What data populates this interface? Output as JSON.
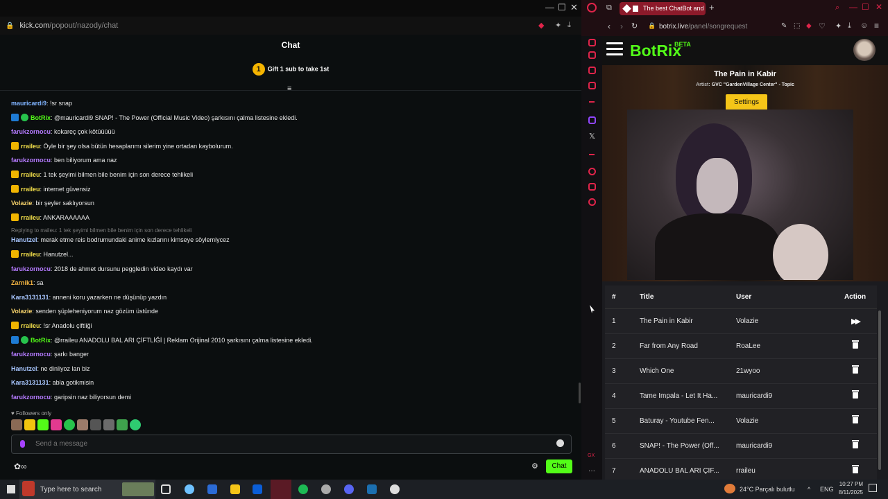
{
  "left_window": {
    "url_host": "kick.com",
    "url_path": "/popout/nazody/chat",
    "chat_title": "Chat",
    "gift_badge": "1",
    "gift_text": "Gift 1 sub to take 1st",
    "messages": [
      {
        "user": "mauricardi9",
        "color": "#7fb3ff",
        "badges": [],
        "text": ": !sr snap"
      },
      {
        "user": "BotRix",
        "color": "#53fc18",
        "badges": [
          "bot",
          "verified"
        ],
        "text": ": @mauricardi9 SNAP! - The Power (Official Music Video) şarkısını çalma listesine ekledi."
      },
      {
        "user": "farukzornocu",
        "color": "#b57bff",
        "badges": [],
        "text": ": kokareç çok kötüüüüü"
      },
      {
        "user": "rraileu",
        "color": "#f5e14b",
        "badges": [
          "crown"
        ],
        "text": ": Öyle bir şey olsa bütün hesaplarımı silerim yine ortadan kaybolurum."
      },
      {
        "user": "farukzornocu",
        "color": "#b57bff",
        "badges": [],
        "text": ": ben biliyorum ama naz"
      },
      {
        "user": "rraileu",
        "color": "#f5e14b",
        "badges": [
          "crown"
        ],
        "text": ": 1 tek şeyimi bilmen bile benim için son derece tehlikeli"
      },
      {
        "user": "rraileu",
        "color": "#f5e14b",
        "badges": [
          "crown"
        ],
        "text": ": internet güvensiz"
      },
      {
        "user": "Volazie",
        "color": "#f7d36b",
        "badges": [],
        "text": ": bir şeyler saklıyorsun"
      },
      {
        "user": "rraileu",
        "color": "#f5e14b",
        "badges": [
          "crown"
        ],
        "text": ": ANKARAAAAAA"
      },
      {
        "reply": "Replying to rraileu: 1 tek şeyimi bilmen bile benim için son derece tehlikeli",
        "user": "Hanutzel",
        "color": "#a8c6ff",
        "badges": [],
        "text": ": merak etme reis bodrumundaki anime kızlarını kimseye söylemiycez"
      },
      {
        "user": "rraileu",
        "color": "#f5e14b",
        "badges": [
          "crown"
        ],
        "text": ": Hanutzel..."
      },
      {
        "user": "farukzornocu",
        "color": "#b57bff",
        "badges": [],
        "text": ": 2018 de ahmet dursunu peggledin video kaydı var"
      },
      {
        "user": "Zarnik1",
        "color": "#f5b642",
        "badges": [],
        "text": ": sa"
      },
      {
        "user": "Kara3131131",
        "color": "#a8c6ff",
        "badges": [],
        "text": ": anneni koru yazarken ne düşünüp yazdın"
      },
      {
        "user": "Volazie",
        "color": "#f7d36b",
        "badges": [],
        "text": ": senden şüpleheniyorum naz gözüm üstünde"
      },
      {
        "user": "rraileu",
        "color": "#f5e14b",
        "badges": [
          "crown"
        ],
        "text": ": !sr Anadolu çiftliği"
      },
      {
        "user": "BotRix",
        "color": "#53fc18",
        "badges": [
          "bot",
          "verified"
        ],
        "text": ": @rraileu ANADOLU BAL ARI ÇİFTLİĞİ | Reklam Orijinal 2010 şarkısını çalma listesine ekledi."
      },
      {
        "user": "farukzornocu",
        "color": "#b57bff",
        "badges": [],
        "text": ": şarkı banger"
      },
      {
        "user": "Hanutzel",
        "color": "#a8c6ff",
        "badges": [],
        "text": ": ne dinliyoz lan biz"
      },
      {
        "user": "Kara3131131",
        "color": "#a8c6ff",
        "badges": [],
        "text": ": abla gotikmisin"
      },
      {
        "user": "farukzornocu",
        "color": "#b57bff",
        "badges": [],
        "text": ": garipsin naz biliyorsun demi"
      }
    ],
    "followers_only": "Followers only",
    "input_placeholder": "Send a message",
    "send_button": "Chat"
  },
  "right_window": {
    "tab_title": "The best ChatBot and",
    "url_host": "botrix.live",
    "url_path": "/panel/songrequest",
    "logo": "BotRix",
    "beta": "BETA",
    "now_playing": {
      "title": "The Pain in Kabir",
      "artist_label": "Artist:",
      "artist": "GVC \"GardenVillage Center\" - Topic"
    },
    "settings_button": "Settings",
    "table": {
      "headers": [
        "#",
        "Title",
        "User",
        "Action"
      ],
      "rows": [
        {
          "n": "1",
          "title": "The Pain in Kabir",
          "user": "Volazie",
          "action": "play"
        },
        {
          "n": "2",
          "title": "Far from Any Road",
          "user": "RoaLee",
          "action": "delete"
        },
        {
          "n": "3",
          "title": "Which One",
          "user": "21wyoo",
          "action": "delete"
        },
        {
          "n": "4",
          "title": "Tame Impala - Let It Ha...",
          "user": "mauricardi9",
          "action": "delete"
        },
        {
          "n": "5",
          "title": "Baturay - Youtube Fen...",
          "user": "Volazie",
          "action": "delete"
        },
        {
          "n": "6",
          "title": "SNAP! - The Power (Off...",
          "user": "mauricardi9",
          "action": "delete"
        },
        {
          "n": "7",
          "title": "ANADOLU BAL ARI ÇİF...",
          "user": "rraileu",
          "action": "delete"
        }
      ]
    }
  },
  "taskbar": {
    "search_placeholder": "Type here to search",
    "weather": "24°C  Parçalı bulutlu",
    "lang": "ENG",
    "time": "10:27 PM",
    "date": "8/11/2025"
  }
}
